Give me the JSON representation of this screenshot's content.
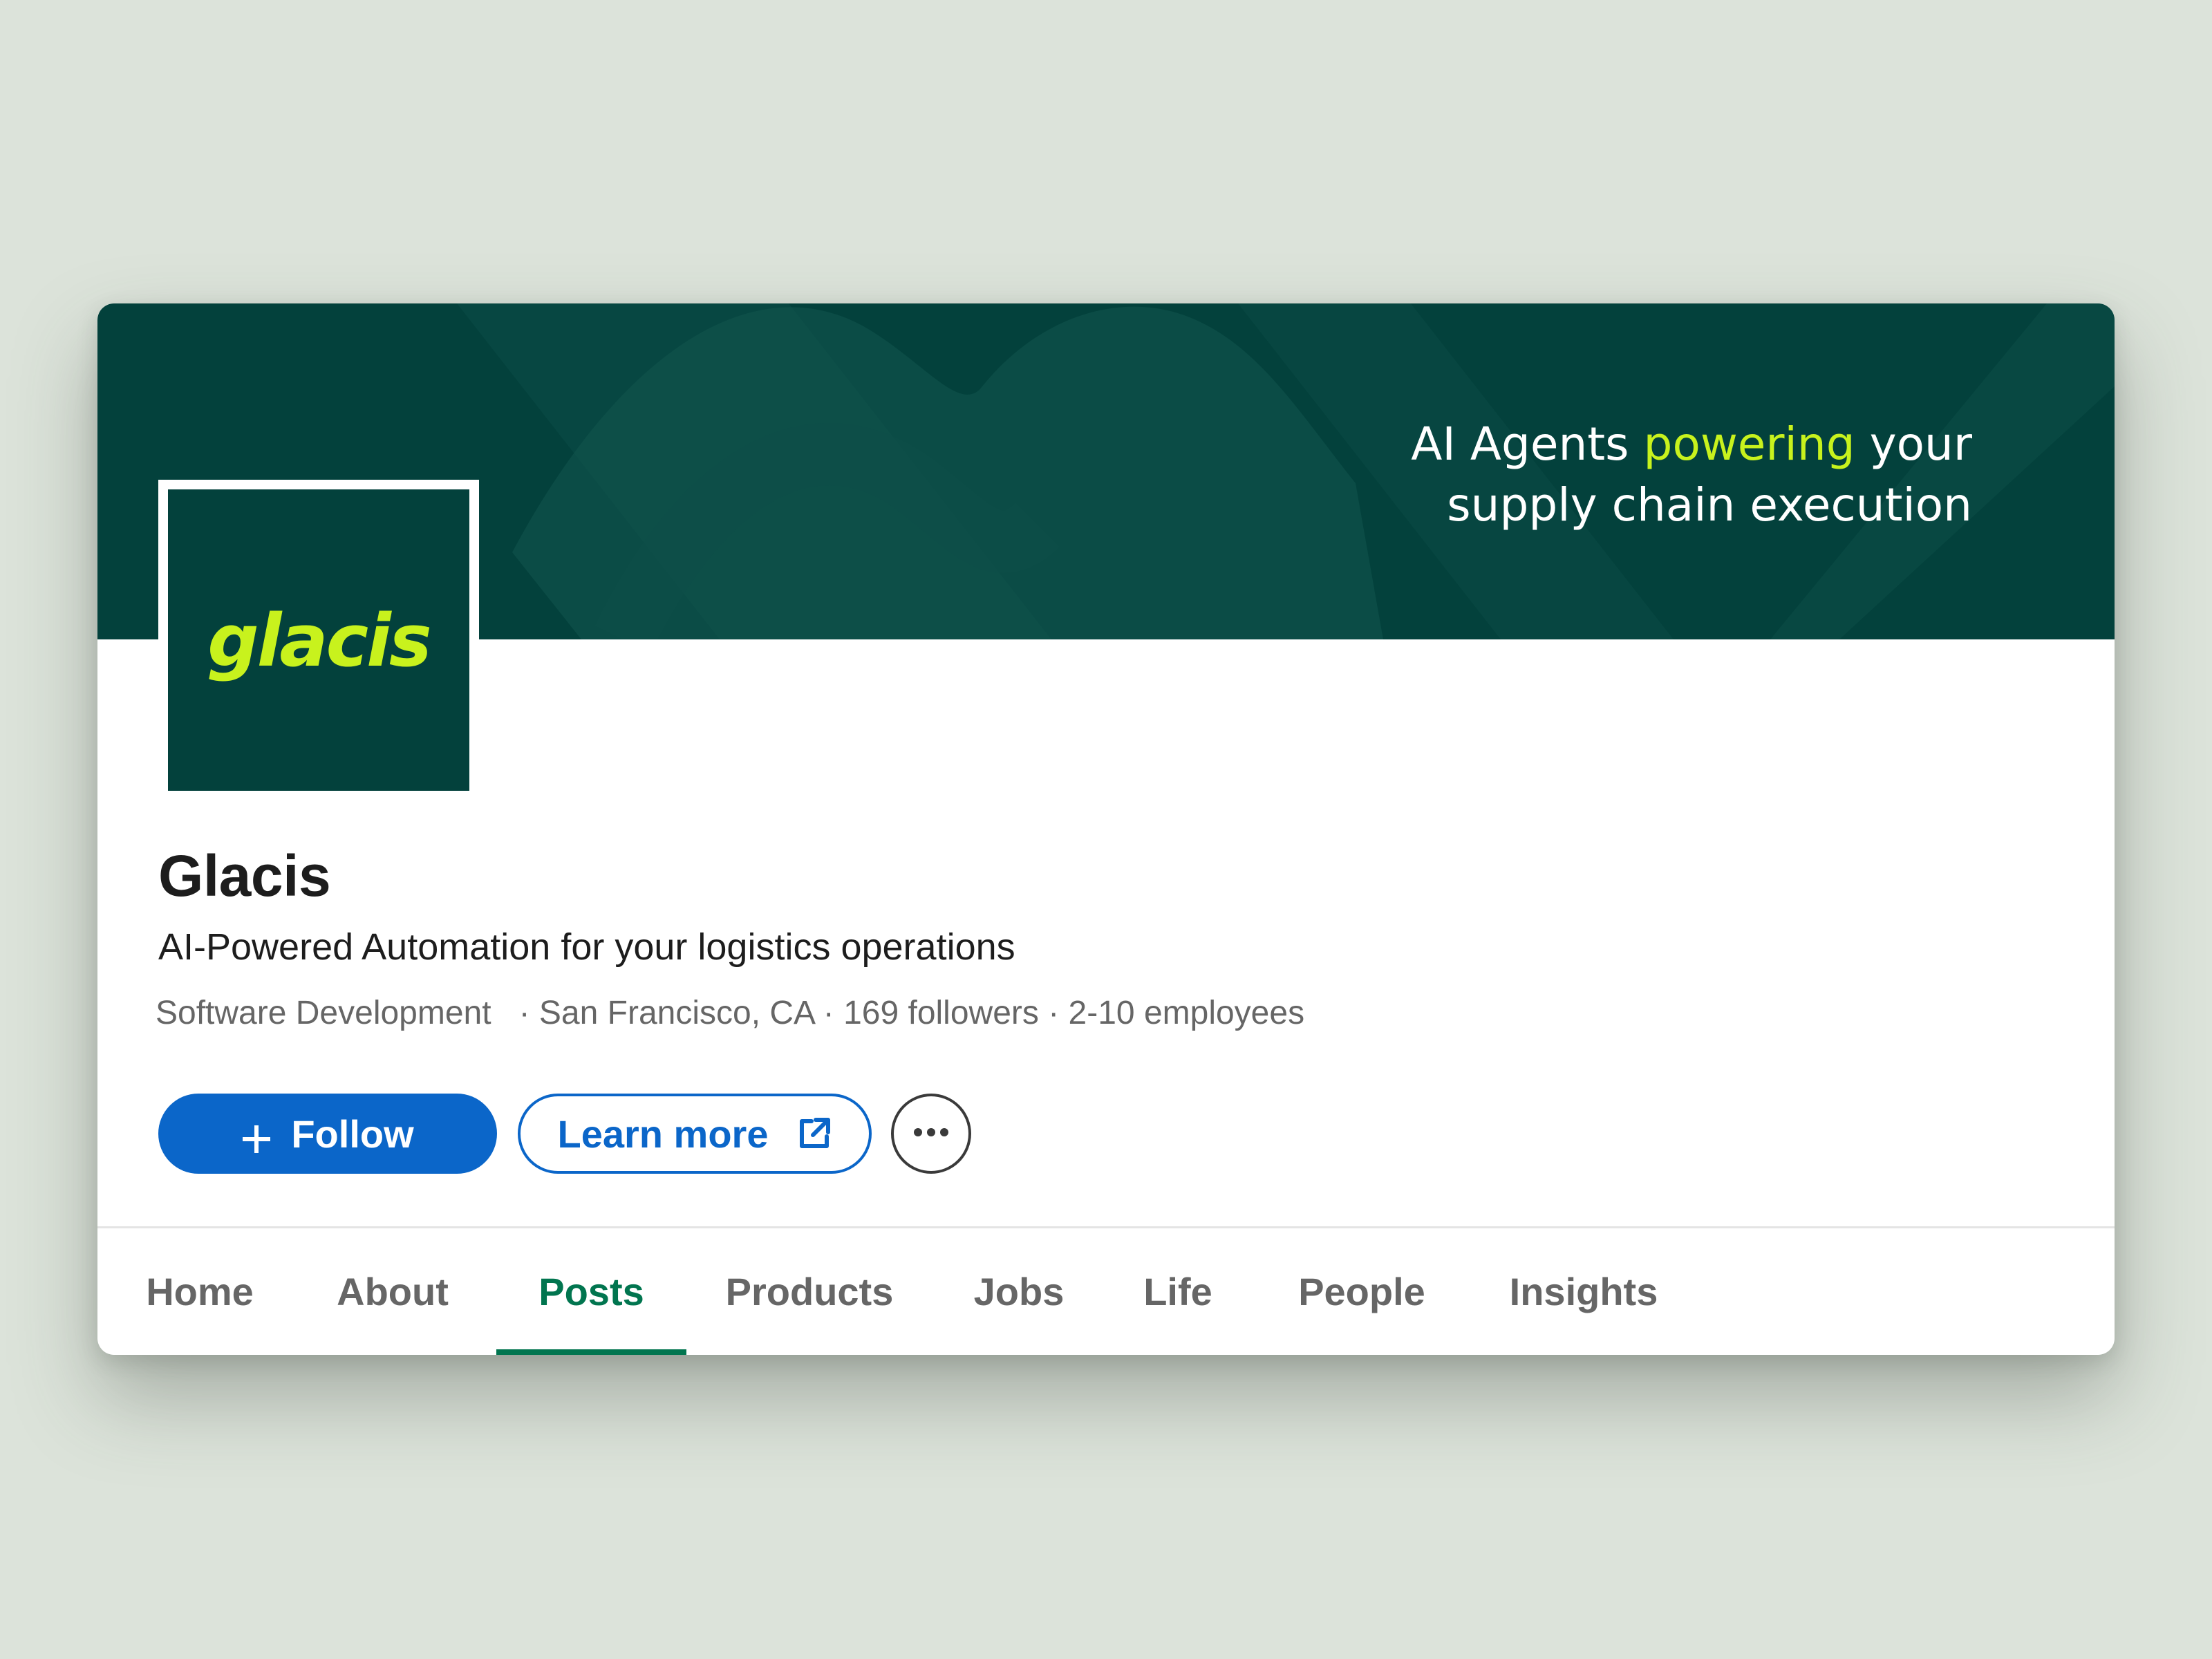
{
  "banner": {
    "tagline_part1": "AI Agents ",
    "tagline_accent": "powering",
    "tagline_part2": " your",
    "tagline_line2": "supply chain execution"
  },
  "logo": {
    "wordmark": "glacis"
  },
  "company": {
    "name": "Glacis",
    "tagline": "AI-Powered Automation for your logistics operations",
    "meta": "Software Development   · San Francisco, CA · 169 followers · 2-10 employees"
  },
  "actions": {
    "follow_label": "Follow",
    "learn_more_label": "Learn more"
  },
  "tabs": [
    {
      "label": "Home",
      "active": false
    },
    {
      "label": "About",
      "active": false
    },
    {
      "label": "Posts",
      "active": true
    },
    {
      "label": "Products",
      "active": false
    },
    {
      "label": "Jobs",
      "active": false
    },
    {
      "label": "Life",
      "active": false
    },
    {
      "label": "People",
      "active": false
    },
    {
      "label": "Insights",
      "active": false
    }
  ],
  "colors": {
    "page_background": "#dce3da",
    "banner": "#03413c",
    "accent_lime": "#c8f21d",
    "primary_blue": "#0b66c9",
    "active_tab_green": "#01754f"
  },
  "icons": {
    "follow": "plus-icon",
    "learn_more": "external-link-icon",
    "more": "ellipsis-icon"
  }
}
